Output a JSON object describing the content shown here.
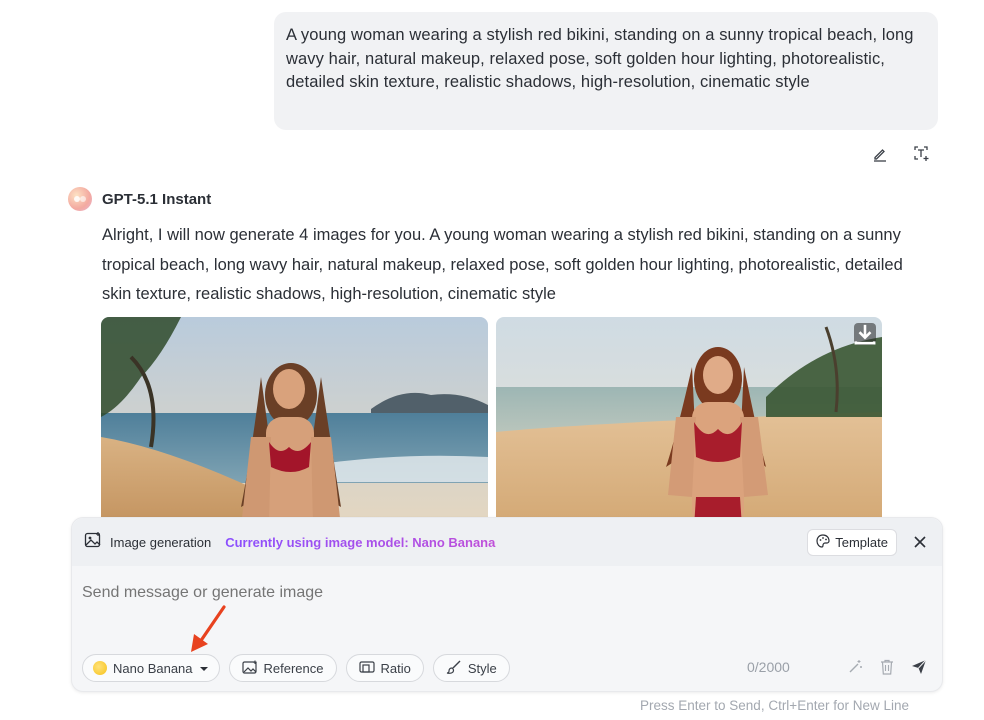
{
  "user_message": {
    "text": "A young woman wearing a stylish red bikini, standing on a sunny tropical beach, long wavy hair, natural makeup, relaxed pose, soft golden hour lighting, photorealistic, detailed skin texture, realistic shadows, high-resolution, cinematic style",
    "actions": [
      "edit-icon",
      "text-edit-icon"
    ]
  },
  "assistant": {
    "name": "GPT-5.1 Instant",
    "text": "Alright, I will now generate 4 images for you. A young woman wearing a stylish red bikini, standing on a sunny tropical beach, long wavy hair, natural makeup, relaxed pose, soft golden hour lighting, photorealistic, detailed skin texture, realistic shadows, high-resolution, cinematic style",
    "images": [
      {
        "icon": "generated-image"
      },
      {
        "icon": "generated-image",
        "download_icon": "download-icon"
      }
    ]
  },
  "composer": {
    "mode_label": "Image generation",
    "model_note": "Currently using image model: Nano Banana",
    "template_label": "Template",
    "placeholder": "Send message or generate image",
    "model_selector": "Nano Banana",
    "reference_label": "Reference",
    "ratio_label": "Ratio",
    "style_label": "Style",
    "char_count": "0/2000",
    "hint": "Press Enter to Send, Ctrl+Enter for New Line"
  },
  "colors": {
    "accent_arrow": "#e8421f",
    "model_note_gradient": [
      "#8a4fff",
      "#c04fd8"
    ],
    "bubble_bg": "#f1f2f4"
  }
}
